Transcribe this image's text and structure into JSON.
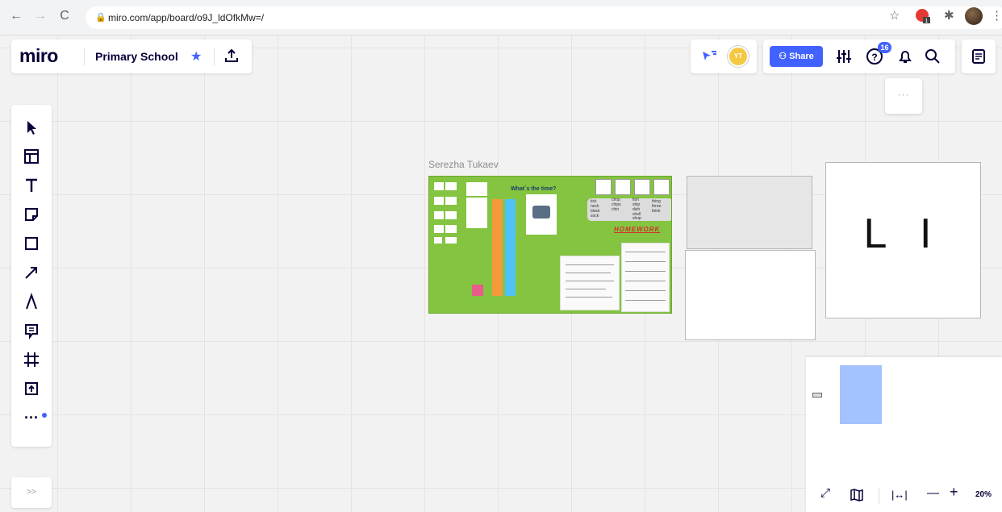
{
  "browser": {
    "url": "miro.com/app/board/o9J_ldOfkMw=/",
    "back_icon": "arrow-left-icon",
    "forward_icon": "arrow-right-icon",
    "reload_icon": "reload-icon",
    "ext_badge": "1"
  },
  "board": {
    "logo": "miro",
    "name": "Primary School",
    "star_icon": "star-icon",
    "upload_icon": "upload-icon"
  },
  "header": {
    "share_label": "Share",
    "user_initials": "YT",
    "help_badge": "16",
    "more_dots": "···"
  },
  "toolbar": {
    "items": [
      "select",
      "templates",
      "text",
      "sticky-note",
      "shape",
      "arrow",
      "pen",
      "comment",
      "frame",
      "upload",
      "more"
    ],
    "more_label": "···",
    "expand_label": ">>"
  },
  "canvas": {
    "author": "Serezha Tukaev",
    "green_frame": {
      "title": "What`s the time?",
      "homework": "HOMEWORK",
      "words": [
        "tick",
        "chop",
        "fish",
        "thing",
        "neck",
        "chips",
        "ship",
        "three",
        "black",
        "chin",
        "dish",
        "think",
        "sock",
        "",
        "shell",
        "",
        "",
        "",
        "shop",
        ""
      ]
    },
    "big_text": "L I"
  },
  "minimap": {
    "zoom": "20%",
    "minus": "—",
    "plus": "+"
  },
  "colors": {
    "accent": "#4262ff",
    "board_green": "#84c441",
    "avatar_yellow": "#f5c842"
  }
}
